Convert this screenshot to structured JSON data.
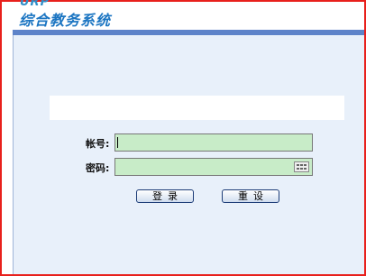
{
  "header": {
    "logo_urp": "URP",
    "title": "综合教务系统"
  },
  "login": {
    "account_label": "帐号:",
    "password_label": "密码:",
    "account_value": "",
    "password_value": "",
    "login_button": "登录",
    "reset_button": "重设"
  },
  "colors": {
    "frame_border": "#e8201c",
    "header_bar": "#5d83c9",
    "background": "#e8f0fa",
    "field_fill": "#c8ecc8"
  }
}
